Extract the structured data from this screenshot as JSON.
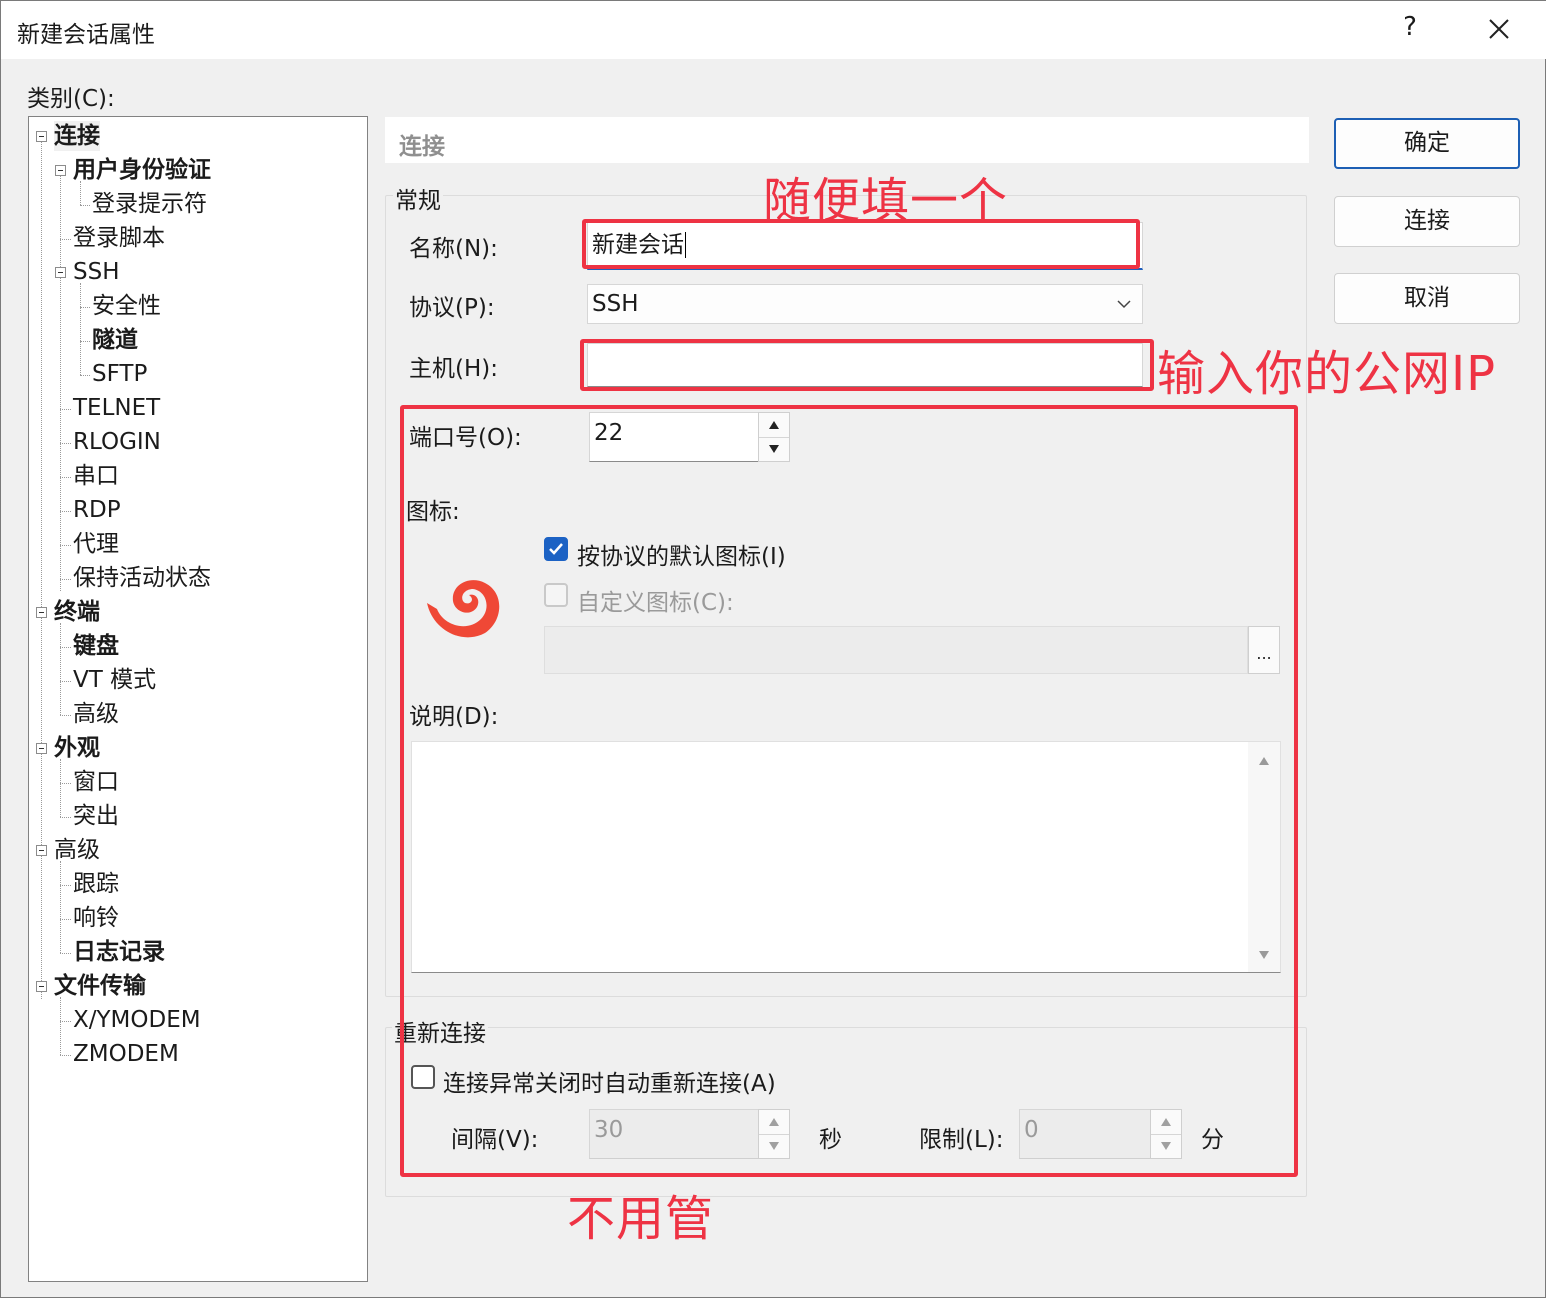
{
  "window": {
    "title": "新建会话属性",
    "help": "?"
  },
  "category_label": "类别(C):",
  "tree": [
    {
      "label": "连接",
      "bold": true,
      "level": 0,
      "expander": true
    },
    {
      "label": "用户身份验证",
      "bold": true,
      "level": 1,
      "expander": true
    },
    {
      "label": "登录提示符",
      "bold": false,
      "level": 2
    },
    {
      "label": "登录脚本",
      "bold": false,
      "level": 1
    },
    {
      "label": "SSH",
      "bold": false,
      "level": 1,
      "expander": true
    },
    {
      "label": "安全性",
      "bold": false,
      "level": 2
    },
    {
      "label": "隧道",
      "bold": true,
      "level": 2
    },
    {
      "label": "SFTP",
      "bold": false,
      "level": 2
    },
    {
      "label": "TELNET",
      "bold": false,
      "level": 1
    },
    {
      "label": "RLOGIN",
      "bold": false,
      "level": 1
    },
    {
      "label": "串口",
      "bold": false,
      "level": 1
    },
    {
      "label": "RDP",
      "bold": false,
      "level": 1
    },
    {
      "label": "代理",
      "bold": false,
      "level": 1
    },
    {
      "label": "保持活动状态",
      "bold": false,
      "level": 1
    },
    {
      "label": "终端",
      "bold": true,
      "level": 0,
      "expander": true
    },
    {
      "label": "键盘",
      "bold": true,
      "level": 1
    },
    {
      "label": "VT 模式",
      "bold": false,
      "level": 1
    },
    {
      "label": "高级",
      "bold": false,
      "level": 1
    },
    {
      "label": "外观",
      "bold": true,
      "level": 0,
      "expander": true
    },
    {
      "label": "窗口",
      "bold": false,
      "level": 1
    },
    {
      "label": "突出",
      "bold": false,
      "level": 1
    },
    {
      "label": "高级",
      "bold": false,
      "level": 0,
      "expander": true
    },
    {
      "label": "跟踪",
      "bold": false,
      "level": 1
    },
    {
      "label": "响铃",
      "bold": false,
      "level": 1
    },
    {
      "label": "日志记录",
      "bold": true,
      "level": 1
    },
    {
      "label": "文件传输",
      "bold": true,
      "level": 0,
      "expander": true
    },
    {
      "label": "X/YMODEM",
      "bold": false,
      "level": 1
    },
    {
      "label": "ZMODEM",
      "bold": false,
      "level": 1
    }
  ],
  "panel": {
    "header": "连接",
    "general_group": "常规",
    "name_label": "名称(N):",
    "name_value": "新建会话",
    "protocol_label": "协议(P):",
    "protocol_value": "SSH",
    "host_label": "主机(H):",
    "host_value": "",
    "port_label": "端口号(O):",
    "port_value": "22",
    "icon_label": "图标:",
    "default_icon_label": "按协议的默认图标(I)",
    "default_icon_checked": true,
    "custom_icon_label": "自定义图标(C):",
    "custom_icon_checked": false,
    "browse_label": "...",
    "desc_label": "说明(D):",
    "desc_value": "",
    "reconnect_group": "重新连接",
    "reconnect_label": "连接异常关闭时自动重新连接(A)",
    "reconnect_checked": false,
    "interval_label": "间隔(V):",
    "interval_value": "30",
    "seconds_label": "秒",
    "limit_label": "限制(L):",
    "limit_value": "0",
    "minutes_label": "分"
  },
  "buttons": {
    "ok": "确定",
    "connect": "连接",
    "cancel": "取消"
  },
  "annotations": {
    "name_note": "随便填一个",
    "host_note": "输入你的公网IP",
    "rest_note": "不用管",
    "color": "#ee3344"
  },
  "colors": {
    "accent": "#1c62c4",
    "icon": "#ef4836"
  }
}
